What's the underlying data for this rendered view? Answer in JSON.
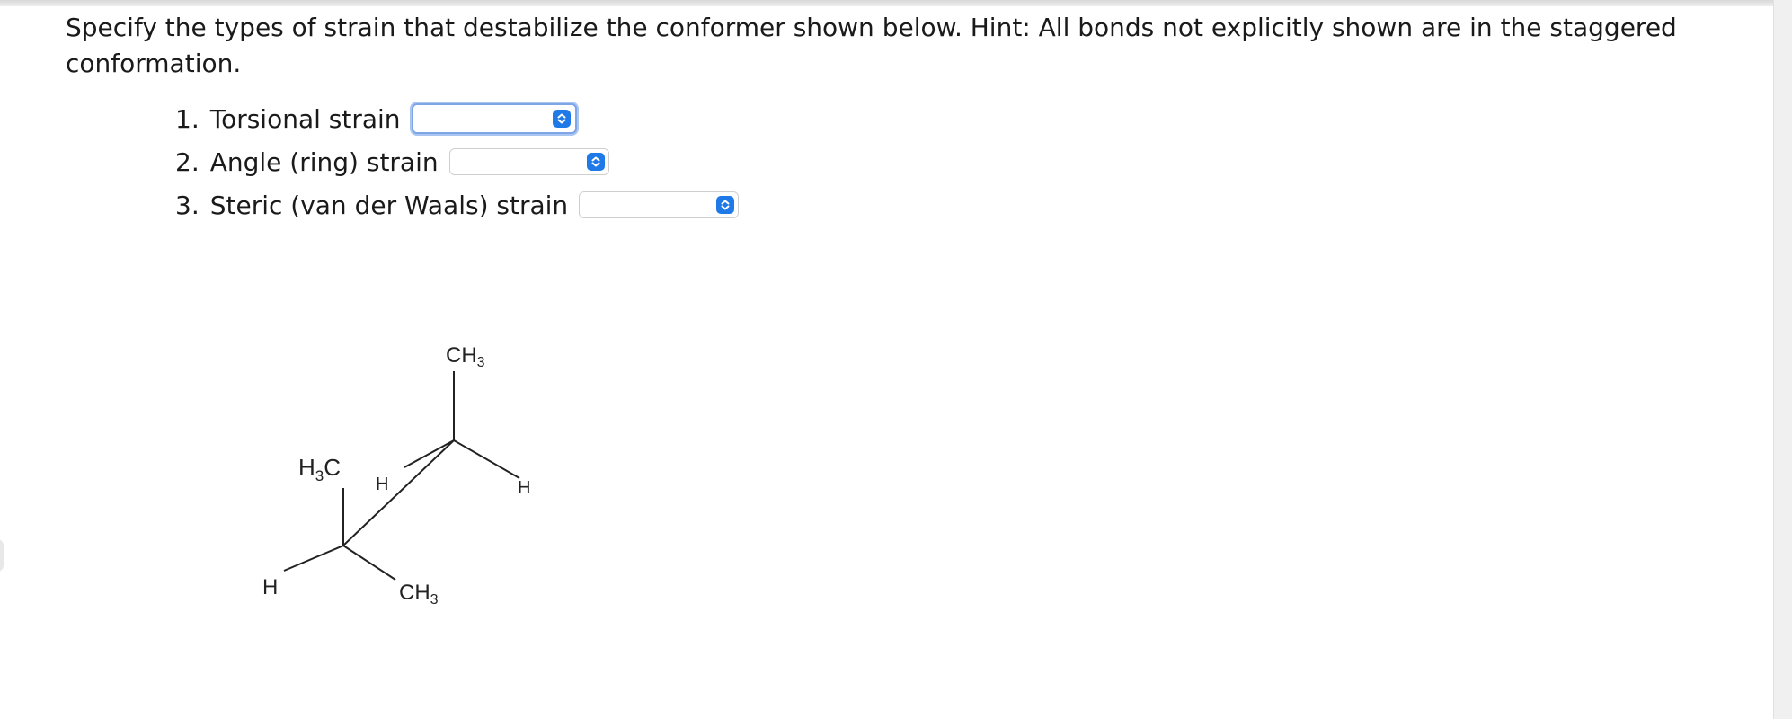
{
  "question": {
    "text": "Specify the types of strain that destabilize the conformer shown below. Hint: All bonds not explicitly shown are in the staggered conformation."
  },
  "strain_options": [
    {
      "number": "1.",
      "label": "Torsional strain",
      "selected": ""
    },
    {
      "number": "2.",
      "label": "Angle (ring) strain",
      "selected": ""
    },
    {
      "number": "3.",
      "label": "Steric (van der Waals) strain",
      "selected": ""
    }
  ],
  "molecule": {
    "top_ch3": "CH",
    "top_ch3_sub": "3",
    "left_h3c_h": "H",
    "left_h3c_sub": "3",
    "left_h3c_c": "C",
    "h_back_left": "H",
    "h_back_right": "H",
    "h_front_left": "H",
    "bottom_ch3": "CH",
    "bottom_ch3_sub": "3"
  },
  "colors": {
    "accent": "#1f7ae8",
    "focus_ring": "#a9c6f2"
  }
}
